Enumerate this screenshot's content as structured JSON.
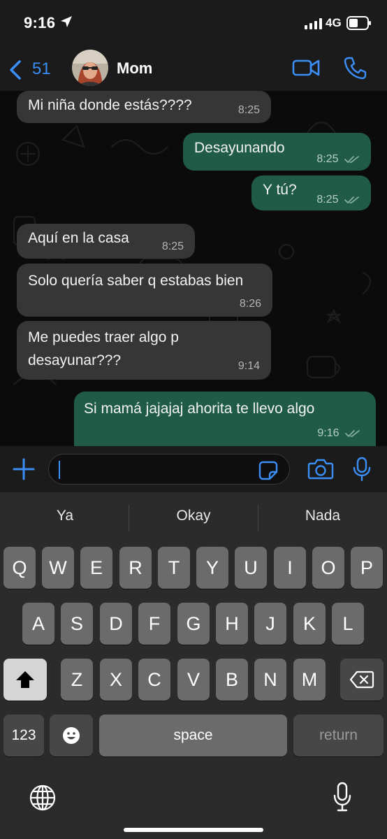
{
  "status_bar": {
    "time": "9:16",
    "network": "4G"
  },
  "header": {
    "back_count": "51",
    "contact_name": "Mom"
  },
  "messages": [
    {
      "dir": "in",
      "text": "Mi niña donde estás????",
      "time": "8:25"
    },
    {
      "dir": "out",
      "text": "Desayunando",
      "time": "8:25"
    },
    {
      "dir": "out",
      "text": "Y tú?",
      "time": "8:25"
    },
    {
      "dir": "in",
      "text": "Aquí en la casa",
      "time": "8:25"
    },
    {
      "dir": "in",
      "text": "Solo quería saber q estabas bien",
      "time": "8:26"
    },
    {
      "dir": "in",
      "line1": "Me puedes traer algo p",
      "line2": "desayunar???",
      "time": "9:14"
    },
    {
      "dir": "out",
      "text": "Si mamá jajajaj ahorita te llevo algo",
      "time": "9:16"
    }
  ],
  "input": {
    "value": ""
  },
  "keyboard": {
    "suggestions": [
      "Ya",
      "Okay",
      "Nada"
    ],
    "row1": [
      "Q",
      "W",
      "E",
      "R",
      "T",
      "Y",
      "U",
      "I",
      "O",
      "P"
    ],
    "row2": [
      "A",
      "S",
      "D",
      "F",
      "G",
      "H",
      "J",
      "K",
      "L"
    ],
    "row3": [
      "Z",
      "X",
      "C",
      "V",
      "B",
      "N",
      "M"
    ],
    "numbers_key": "123",
    "space_key": "space",
    "return_key": "return"
  },
  "colors": {
    "accent": "#3a8ef6",
    "incoming": "#363636",
    "outgoing": "#1f5b47"
  }
}
